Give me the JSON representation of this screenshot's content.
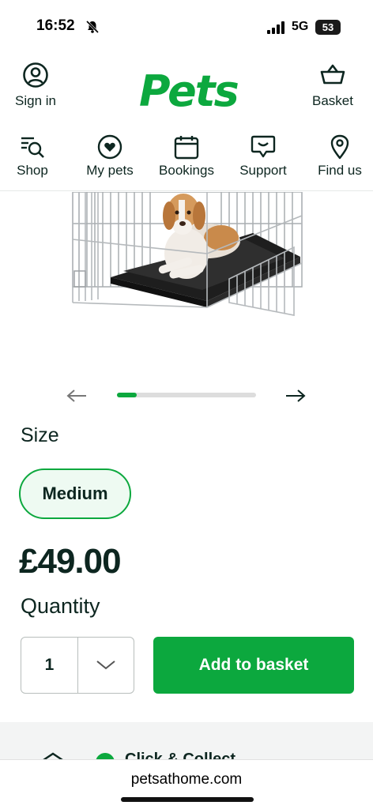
{
  "status": {
    "time": "16:52",
    "network": "5G",
    "battery": "53"
  },
  "header": {
    "logo": "Pets",
    "sign_in": "Sign in",
    "basket": "Basket"
  },
  "nav": [
    {
      "label": "Shop",
      "icon": "search-list-icon"
    },
    {
      "label": "My pets",
      "icon": "heart-icon"
    },
    {
      "label": "Bookings",
      "icon": "calendar-icon"
    },
    {
      "label": "Support",
      "icon": "chat-icon"
    },
    {
      "label": "Find us",
      "icon": "location-pin-icon"
    }
  ],
  "carousel": {
    "progress": 0.14
  },
  "product": {
    "size_label": "Size",
    "size_selected": "Medium",
    "price": "£49.00",
    "quantity_label": "Quantity",
    "quantity": "1",
    "add_button": "Add to basket"
  },
  "lower": {
    "partial_text": "Click & Collect"
  },
  "browser": {
    "url": "petsathome.com"
  },
  "colors": {
    "brand": "#0ca83e",
    "text": "#0d2620"
  }
}
